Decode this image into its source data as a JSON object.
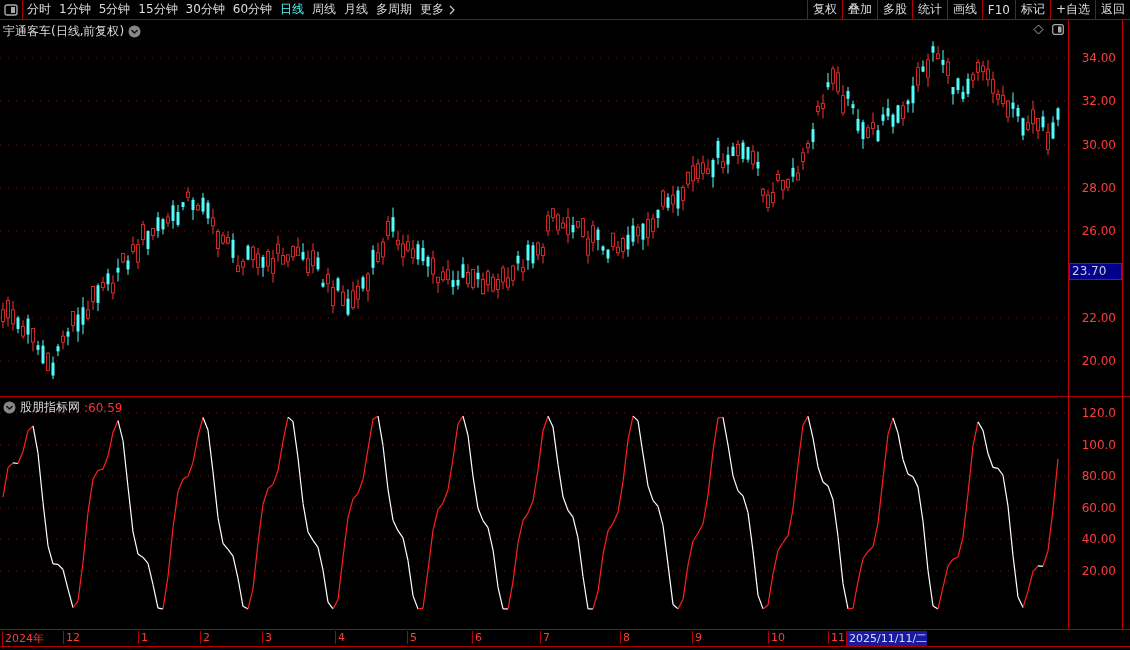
{
  "toolbar": {
    "periods": [
      {
        "label": "分时",
        "selected": false
      },
      {
        "label": "1分钟",
        "selected": false
      },
      {
        "label": "5分钟",
        "selected": false
      },
      {
        "label": "15分钟",
        "selected": false
      },
      {
        "label": "30分钟",
        "selected": false
      },
      {
        "label": "60分钟",
        "selected": false
      },
      {
        "label": "日线",
        "selected": true
      },
      {
        "label": "周线",
        "selected": false
      },
      {
        "label": "月线",
        "selected": false
      },
      {
        "label": "多周期",
        "selected": false
      },
      {
        "label": "更多",
        "selected": false
      }
    ],
    "buttons": [
      "复权",
      "叠加",
      "多股",
      "统计",
      "画线",
      "F10",
      "标记",
      "+自选",
      "返回"
    ]
  },
  "main_chart": {
    "title": "宇通客车(日线,前复权)",
    "yticks": [
      "34.00",
      "32.00",
      "30.00",
      "28.00",
      "26.00",
      "22.00",
      "20.00"
    ],
    "price_tag": "23.70"
  },
  "indicator": {
    "name": "股朋指标网",
    "value": ":60.59",
    "yticks": [
      "120.0",
      "100.0",
      "80.00",
      "60.00",
      "40.00",
      "20.00"
    ]
  },
  "date_axis": {
    "labels": [
      "2024年",
      "12",
      "1",
      "2",
      "3",
      "4",
      "5",
      "6",
      "7",
      "8",
      "9",
      "10",
      "11"
    ],
    "cursor_date": "2025/11/11/二"
  }
}
